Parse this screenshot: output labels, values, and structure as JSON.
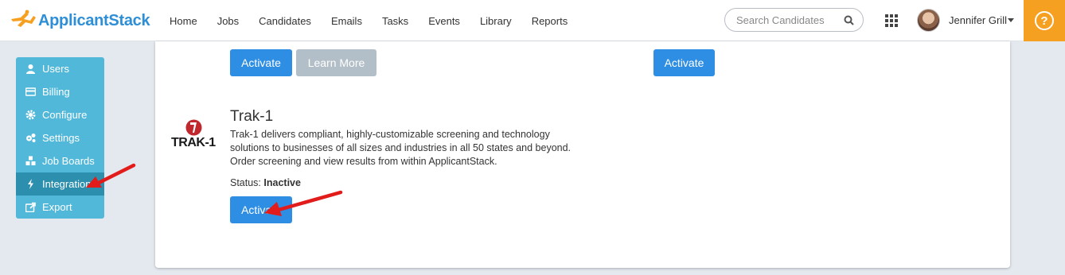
{
  "brand": {
    "name_part1": "Applicant",
    "name_part2": "Stack"
  },
  "nav": {
    "items": [
      "Home",
      "Jobs",
      "Candidates",
      "Emails",
      "Tasks",
      "Events",
      "Library",
      "Reports"
    ]
  },
  "search": {
    "placeholder": "Search Candidates",
    "value": ""
  },
  "user": {
    "name": "Jennifer Grill"
  },
  "help": {
    "label": "?"
  },
  "sidebar": {
    "items": [
      {
        "label": "Users",
        "icon": "user-icon"
      },
      {
        "label": "Billing",
        "icon": "credit-card-icon"
      },
      {
        "label": "Configure",
        "icon": "gear-icon"
      },
      {
        "label": "Settings",
        "icon": "gears-icon"
      },
      {
        "label": "Job Boards",
        "icon": "cubes-icon"
      },
      {
        "label": "Integrations",
        "icon": "bolt-icon",
        "active": true
      },
      {
        "label": "Export",
        "icon": "share-icon"
      }
    ]
  },
  "top_buttons": {
    "activate_left": "Activate",
    "learn_more": "Learn More",
    "activate_right": "Activate"
  },
  "integration": {
    "logo_text": "TRAK-1",
    "title": "Trak-1",
    "description_lines": [
      "Trak-1 delivers compliant, highly-customizable screening and technology",
      "solutions to businesses of all sizes and industries in all 50 states and beyond.",
      "Order screening and view results from within ApplicantStack."
    ],
    "status_label": "Status:",
    "status_value": "Inactive",
    "activate_label": "Activate"
  },
  "colors": {
    "primary": "#2e8ee3",
    "sidebar": "#52b8d9",
    "sidebar_active": "#2d8fae",
    "help": "#f6a021",
    "annotation_arrow": "#e21b1b"
  }
}
